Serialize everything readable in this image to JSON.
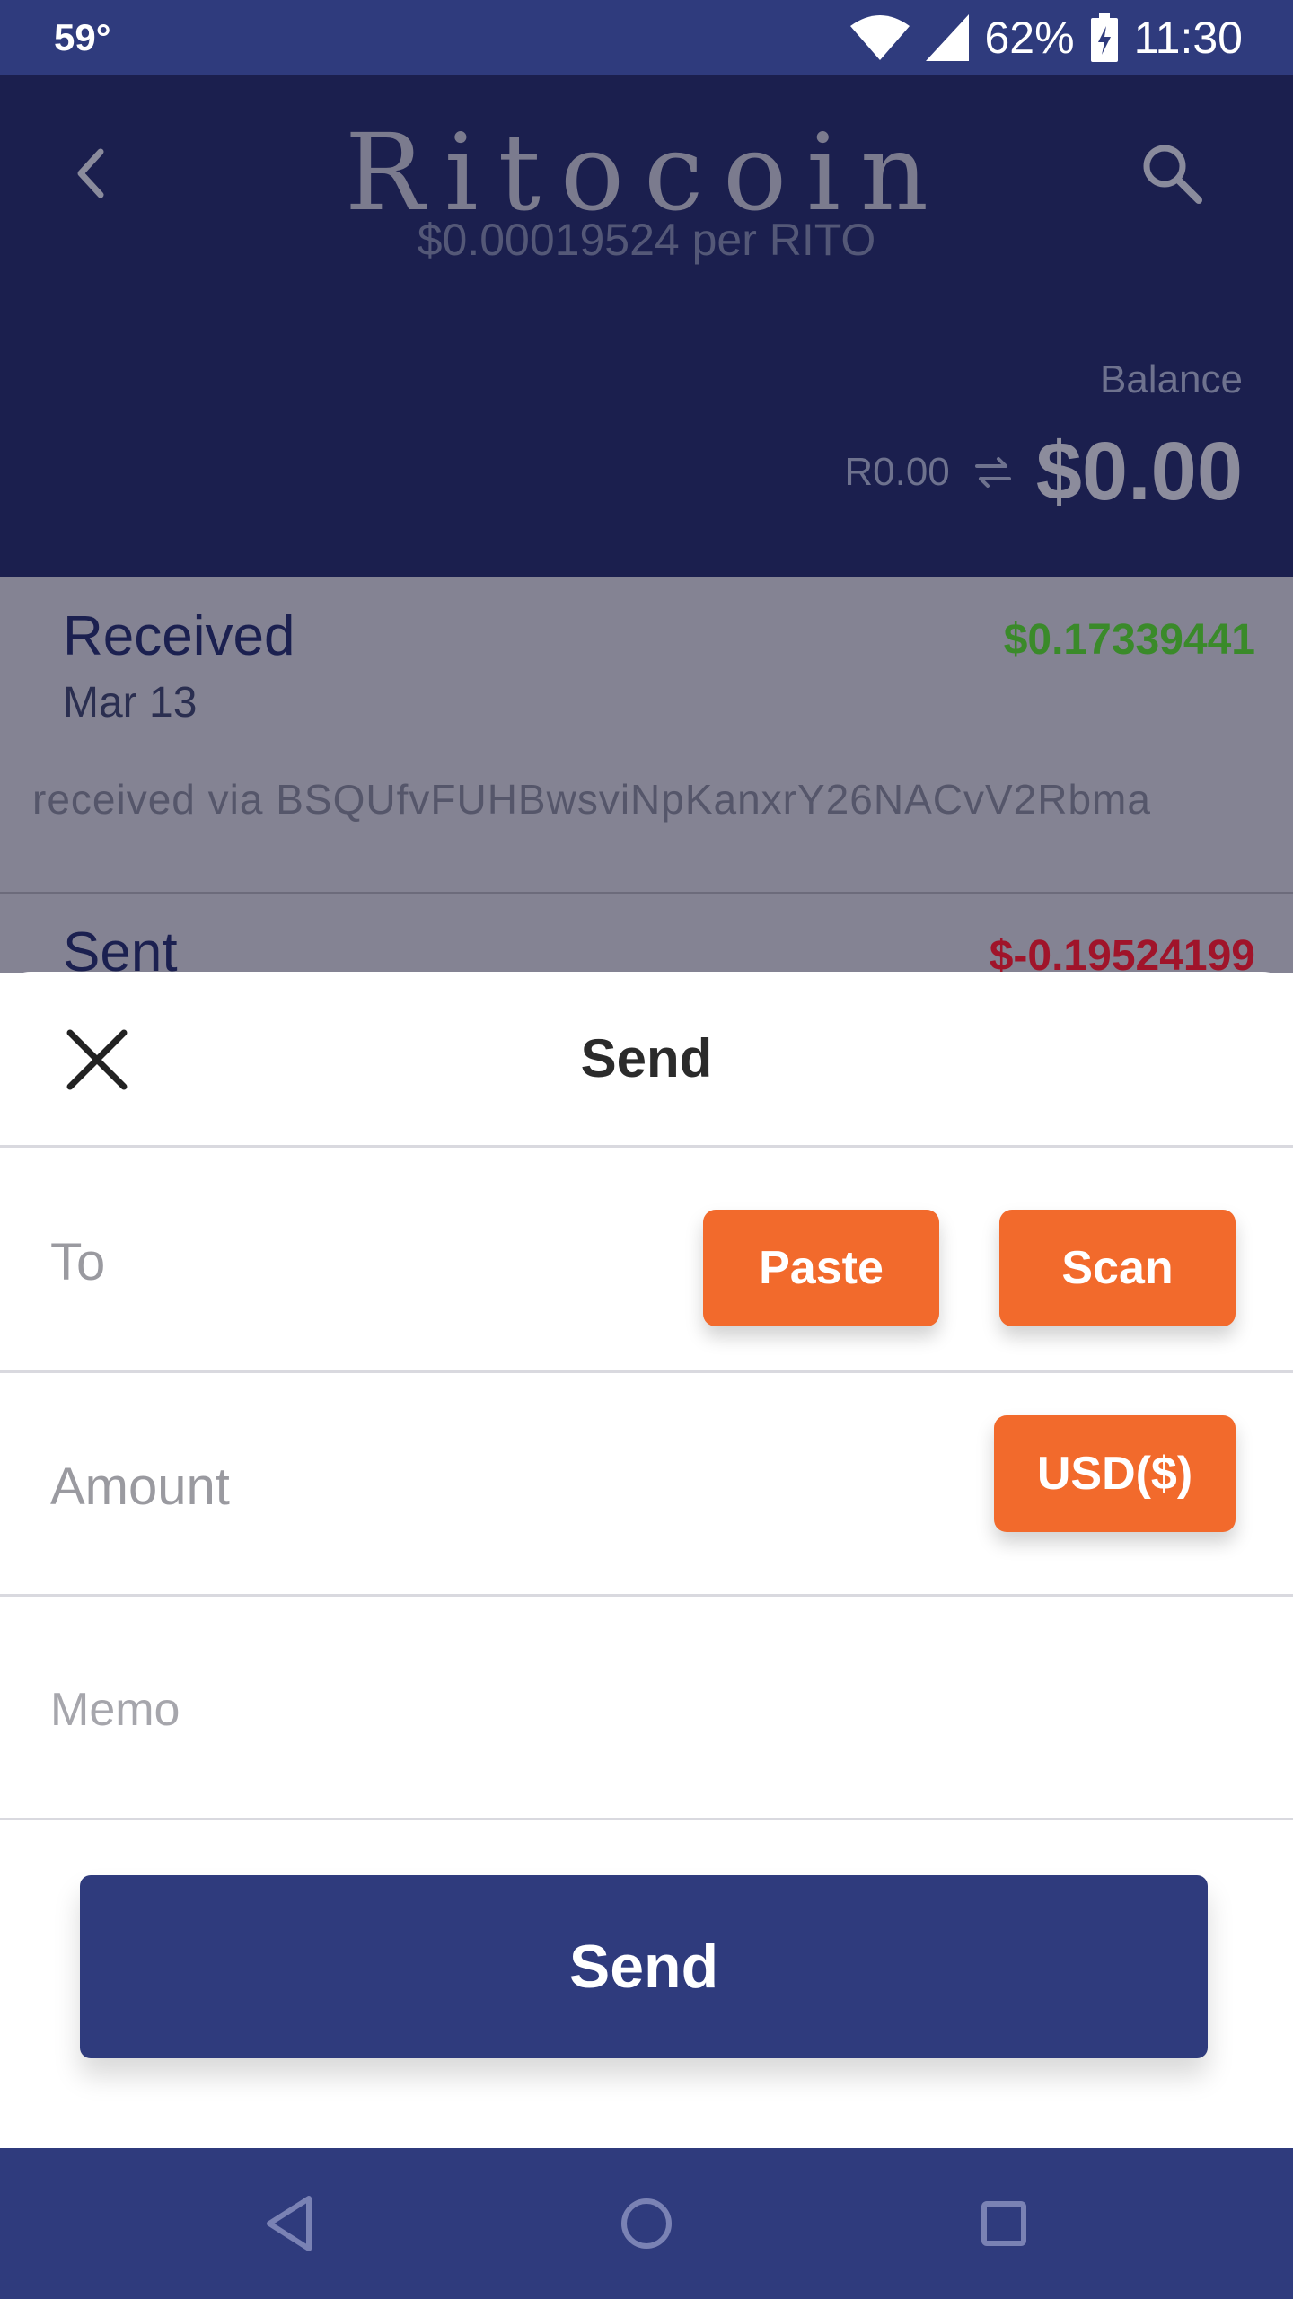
{
  "status_bar": {
    "temperature": "59°",
    "battery": "62%",
    "time": "11:30"
  },
  "header": {
    "app_title": "Ritocoin",
    "price_line": "$0.00019524 per RITO",
    "balance_label": "Balance",
    "balance_crypto": "R0.00",
    "balance_usd": "$0.00"
  },
  "transactions": [
    {
      "title": "Received",
      "date": "Mar 13",
      "amount": "$0.17339441",
      "memo": "received via BSQUfvFUHBwsviNpKanxrY26NACvV2Rbma",
      "amount_color": "#3a8a2a"
    },
    {
      "title": "Sent",
      "amount": "$-0.19524199",
      "amount_color": "#a0142a"
    }
  ],
  "send_sheet": {
    "title": "Send",
    "to_label": "To",
    "paste_label": "Paste",
    "scan_label": "Scan",
    "amount_label": "Amount",
    "currency_label": "USD($)",
    "memo_placeholder": "Memo",
    "send_label": "Send"
  },
  "colors": {
    "accent": "#f26a2c",
    "primary": "#2f3b7d",
    "header_bg": "#1b1f4e"
  }
}
